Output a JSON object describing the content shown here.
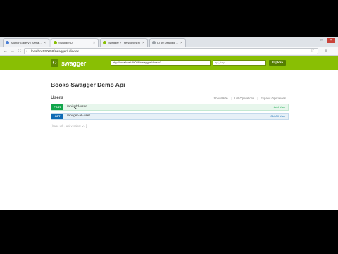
{
  "browser": {
    "tabs": [
      {
        "label": "Anchor Gallery | Xamalline",
        "favicon_color": "#4a7fd6",
        "active": false
      },
      {
        "label": "Swagger UI",
        "favicon_color": "#89bf04",
        "active": true
      },
      {
        "label": "Swagger + The World's M",
        "favicon_color": "#89bf04",
        "active": false
      },
      {
        "label": "ID 50 Detailed Ove",
        "favicon_color": "#9aa0a6",
        "active": false
      }
    ],
    "address": "localhost:50058/swagger/ui/index",
    "close_glyph": "×",
    "back_glyph": "←",
    "forward_glyph": "→",
    "reload_glyph": "C",
    "star_glyph": "☆",
    "menu_glyph": "≡"
  },
  "swagger_header": {
    "logo_text": "swagger",
    "url_value": "http://localhost:50058/swagger/docs/v1",
    "api_key_placeholder": "api_key",
    "explore_label": "Explore"
  },
  "page": {
    "title": "Books Swagger Demo Api",
    "resource": {
      "name": "Users",
      "actions": [
        "Show/Hide",
        "List Operations",
        "Expand Operations"
      ]
    },
    "operations": [
      {
        "method": "POST",
        "path": "/api/add-user",
        "summary": "Add User"
      },
      {
        "method": "GET",
        "path": "/api/get-all-user",
        "summary": "Get All User"
      }
    ],
    "base_url": "[ base url: , api version: v1 ]"
  }
}
